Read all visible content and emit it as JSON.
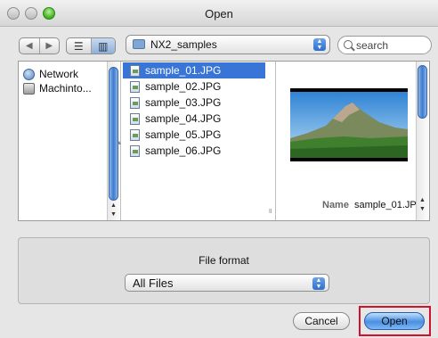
{
  "window": {
    "title": "Open"
  },
  "toolbar": {
    "nav_back": "◀",
    "nav_forward": "▶",
    "view_list": "☰",
    "view_columns": "▥",
    "location": "NX2_samples",
    "search_placeholder": "search"
  },
  "sidebar": {
    "items": [
      {
        "label": "Network",
        "icon": "network-globe-icon"
      },
      {
        "label": "Machinto...",
        "icon": "hard-drive-icon"
      }
    ]
  },
  "files": [
    {
      "name": "sample_01.JPG",
      "selected": true
    },
    {
      "name": "sample_02.JPG",
      "selected": false
    },
    {
      "name": "sample_03.JPG",
      "selected": false
    },
    {
      "name": "sample_04.JPG",
      "selected": false
    },
    {
      "name": "sample_05.JPG",
      "selected": false
    },
    {
      "name": "sample_06.JPG",
      "selected": false
    }
  ],
  "preview": {
    "name_label": "Name",
    "name_value": "sample_01.JP"
  },
  "format": {
    "label": "File format",
    "selected": "All Files"
  },
  "buttons": {
    "cancel": "Cancel",
    "open": "Open"
  },
  "colors": {
    "selection": "#3875d7",
    "highlight_box": "#d0122b",
    "default_button": "#4a8fe0"
  }
}
